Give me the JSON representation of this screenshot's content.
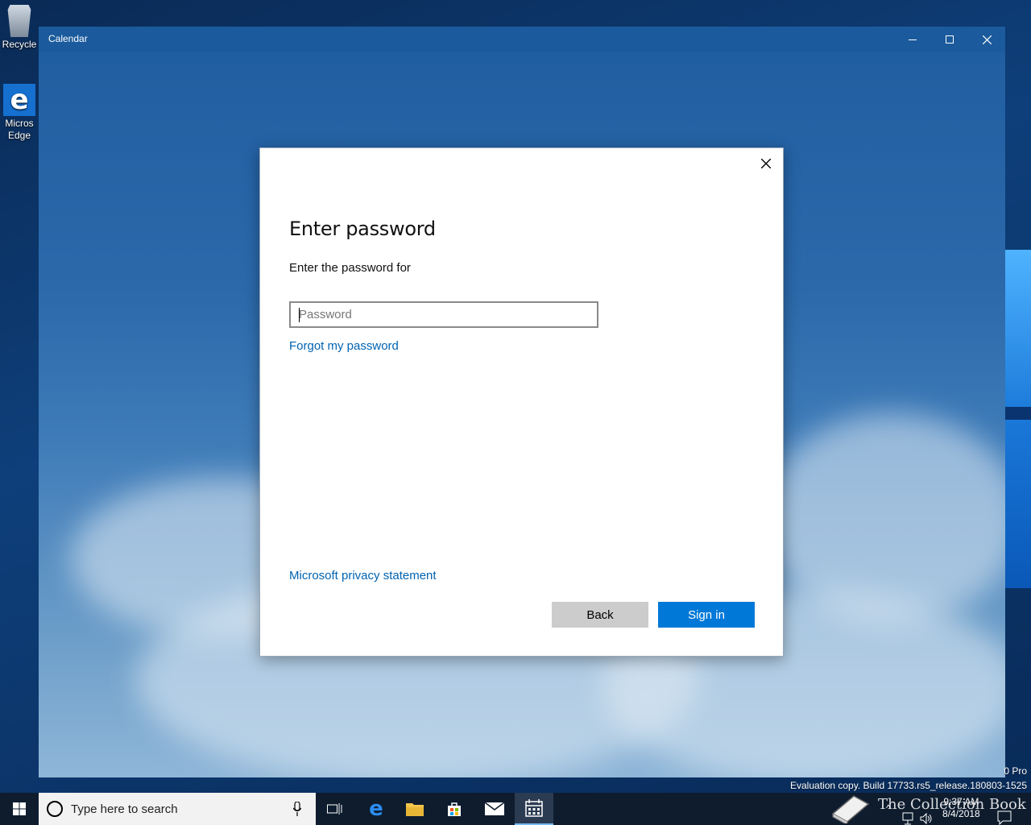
{
  "desktop": {
    "icons": [
      {
        "label": "Recycle"
      },
      {
        "label": "Micros\nEdge",
        "line1": "Micros",
        "line2": "Edge"
      }
    ],
    "watermark": {
      "line1": "0 Pro",
      "line2": "Evaluation copy. Build 17733.rs5_release.180803-1525"
    }
  },
  "window": {
    "title": "Calendar"
  },
  "dialog": {
    "title": "Enter password",
    "subtitle": "Enter the password for",
    "password_placeholder": "Password",
    "forgot_link": "Forgot my password",
    "privacy_link": "Microsoft privacy statement",
    "back_label": "Back",
    "signin_label": "Sign in"
  },
  "taskbar": {
    "search_placeholder": "Type here to search",
    "brand_text": "The Collection Book",
    "time": "9:37 AM",
    "date": "8/4/2018"
  },
  "colors": {
    "accent": "#0078d7",
    "link": "#0063b1",
    "titlebar": "#1b5a9c"
  }
}
